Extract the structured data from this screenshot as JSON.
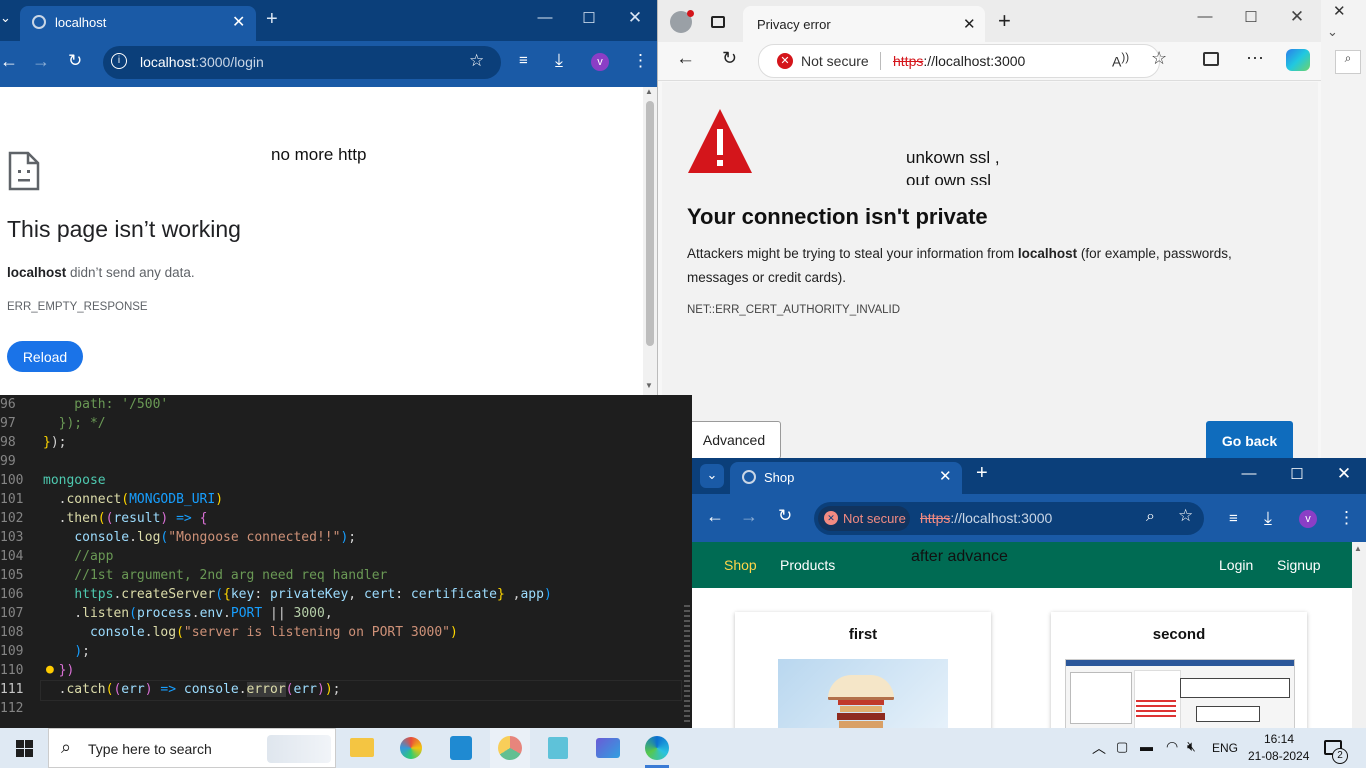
{
  "chrome": {
    "tab_title": "localhost",
    "url": "localhost:3000/login",
    "url_host": "localhost",
    "url_path": ":3000/login",
    "profile_initial": "v",
    "annotation": "no more http",
    "error_title": "This page isn’t working",
    "error_host": "localhost",
    "error_desc": " didn’t send any data.",
    "error_code": "ERR_EMPTY_RESPONSE",
    "reload_label": "Reload"
  },
  "edge": {
    "tab_title": "Privacy error",
    "not_secure_label": "Not secure",
    "url_scheme": "https",
    "url_rest": "://localhost:3000",
    "annotation_line1": "unkown ssl ,",
    "annotation_line2": "out own ssl",
    "heading": "Your connection isn't private",
    "body_prefix": "Attackers might be trying to steal your information from ",
    "body_host": "localhost",
    "body_suffix": " (for example, passwords,",
    "body_line2": "messages or credit cards).",
    "error_code": "NET::ERR_CERT_AUTHORITY_INVALID",
    "advanced_label": "Advanced",
    "go_back_label": "Go back"
  },
  "editor": {
    "lines": [
      {
        "num": "96",
        "text": "    path: '/500'"
      },
      {
        "num": "97",
        "text": "  }); */"
      },
      {
        "num": "98",
        "text": "});"
      },
      {
        "num": "99",
        "text": ""
      },
      {
        "num": "100",
        "text": "mongoose"
      },
      {
        "num": "101",
        "text": "  .connect(MONGODB_URI)"
      },
      {
        "num": "102",
        "text": "  .then((result) => {"
      },
      {
        "num": "103",
        "text": "    console.log(\"Mongoose connected!!\");"
      },
      {
        "num": "104",
        "text": "    //app"
      },
      {
        "num": "105",
        "text": "    //1st argument, 2nd arg need req handler"
      },
      {
        "num": "106",
        "text": "    https.createServer({key: privateKey, cert: certificate} ,app)"
      },
      {
        "num": "107",
        "text": "    .listen(process.env.PORT || 3000,"
      },
      {
        "num": "108",
        "text": "      console.log(\"server is listening on PORT 3000\")"
      },
      {
        "num": "109",
        "text": "    );"
      },
      {
        "num": "110",
        "text": "  })"
      },
      {
        "num": "111",
        "text": "  .catch((err) => console.error(err));"
      },
      {
        "num": "112",
        "text": ""
      }
    ]
  },
  "shop": {
    "tab_title": "Shop",
    "not_secure_label": "Not secure",
    "url_scheme": "https",
    "url_rest": "://localhost:3000",
    "profile_initial": "v",
    "annotation": "after advance",
    "nav_shop": "Shop",
    "nav_products": "Products",
    "nav_login": "Login",
    "nav_signup": "Signup",
    "card1_title": "first",
    "card2_title": "second"
  },
  "taskbar": {
    "search_placeholder": "Type here to search",
    "language": "ENG",
    "time": "16:14",
    "date": "21-08-2024",
    "notification_count": "2"
  },
  "colors": {
    "chrome_frame": "#0b3f7a",
    "chrome_toolbar": "#1a5aa6",
    "reload_blue": "#1a73e8",
    "edge_warning_red": "#d4151b",
    "edge_go_back": "#0f6cbd",
    "shop_nav": "#006b53",
    "shop_active_link": "#ffd54a"
  }
}
